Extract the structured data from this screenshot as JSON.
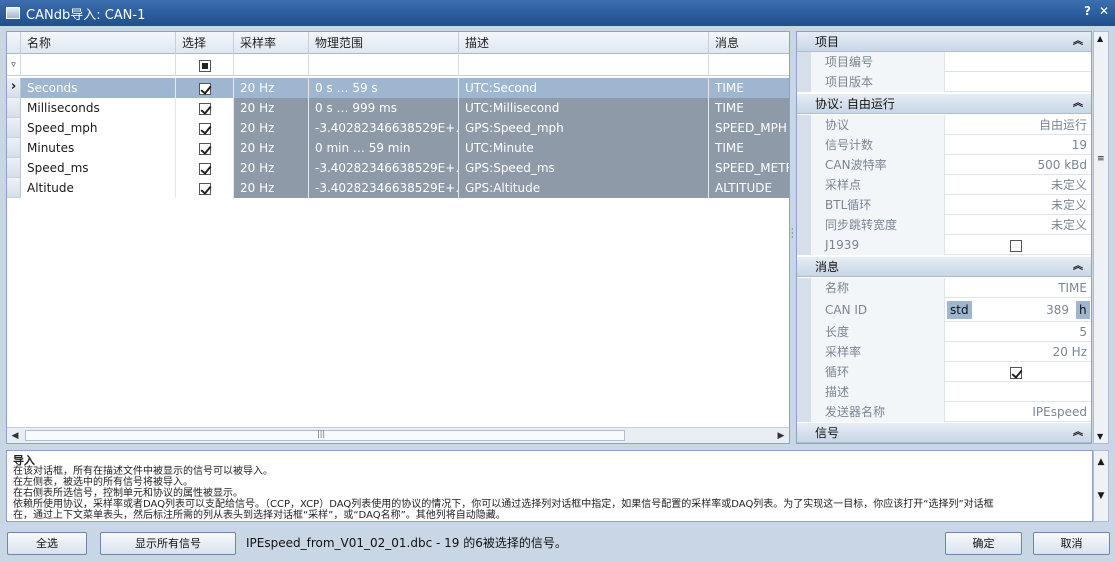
{
  "window": {
    "title": "CANdb导入: CAN-1",
    "help_btn": "?",
    "close_btn": "✕"
  },
  "grid": {
    "columns": [
      {
        "label": "名称"
      },
      {
        "label": "选择"
      },
      {
        "label": "采样率"
      },
      {
        "label": "物理范围"
      },
      {
        "label": "描述"
      },
      {
        "label": "消息"
      }
    ],
    "rows": [
      {
        "name": "Seconds",
        "rate": "20 Hz",
        "range": "0 s … 59 s",
        "desc": "UTC:Second",
        "msg": "TIME"
      },
      {
        "name": "Milliseconds",
        "rate": "20 Hz",
        "range": "0 s … 999 ms",
        "desc": "UTC:Millisecond",
        "msg": "TIME"
      },
      {
        "name": "Speed_mph",
        "rate": "20 Hz",
        "range": "-3.40282346638529E+…",
        "desc": "GPS:Speed_mph",
        "msg": "SPEED_MPH"
      },
      {
        "name": "Minutes",
        "rate": "20 Hz",
        "range": "0 min … 59 min",
        "desc": "UTC:Minute",
        "msg": "TIME"
      },
      {
        "name": "Speed_ms",
        "rate": "20 Hz",
        "range": "-3.40282346638529E+…",
        "desc": "GPS:Speed_ms",
        "msg": "SPEED_METR"
      },
      {
        "name": "Altitude",
        "rate": "20 Hz",
        "range": "-3.40282346638529E+…",
        "desc": "GPS:Altitude",
        "msg": "ALTITUDE"
      }
    ]
  },
  "props": {
    "sec_item": "项目",
    "item_no": "项目编号",
    "item_ver": "项目版本",
    "sec_proto": "协议: 自由运行",
    "proto": {
      "k": "协议",
      "v": "自由运行"
    },
    "sigcount": {
      "k": "信号计数",
      "v": "19"
    },
    "baud": {
      "k": "CAN波特率",
      "v": "500 kBd"
    },
    "sample": {
      "k": "采样点",
      "v": "未定义"
    },
    "btl": {
      "k": "BTL循环",
      "v": "未定义"
    },
    "sjw": {
      "k": "同步跳转宽度",
      "v": "未定义"
    },
    "j1939": {
      "k": "J1939"
    },
    "sec_msg": "消息",
    "mname": {
      "k": "名称",
      "v": "TIME"
    },
    "canid": {
      "k": "CAN ID",
      "std": "std",
      "v": "389",
      "h": "h"
    },
    "len": {
      "k": "长度",
      "v": "5"
    },
    "mrate": {
      "k": "采样率",
      "v": "20 Hz"
    },
    "loop": {
      "k": "循环"
    },
    "mdesc": {
      "k": "描述"
    },
    "sender": {
      "k": "发送器名称",
      "v": "IPEspeed"
    },
    "sec_sig": "信号"
  },
  "help": {
    "title": "导入",
    "lines": [
      "在该对话框，所有在描述文件中被显示的信号可以被导入。",
      "在左侧表，被选中的所有信号将被导入。",
      "在右侧表所选信号，控制单元和协议的属性被显示。",
      "依赖所使用协议，采样率或者DAQ列表可以支配给信号。（CCP，XCP）DAQ列表使用的协议的情况下，你可以通过选择列对话框中指定，如果信号配置的采样率或DAQ列表。为了实现这一目标，你应该打开“选择列”对话框",
      "在，通过上下文菜单表头，然后标注所需的列从表头到选择对话框“采样”，或“DAQ名称”。其他列将自动隐藏。"
    ]
  },
  "footer": {
    "select_all": "全选",
    "show_all": "显示所有信号",
    "status": "IPEspeed_from_V01_02_01.dbc  -  19 的6被选择的信号。",
    "ok": "确定",
    "cancel": "取消"
  }
}
